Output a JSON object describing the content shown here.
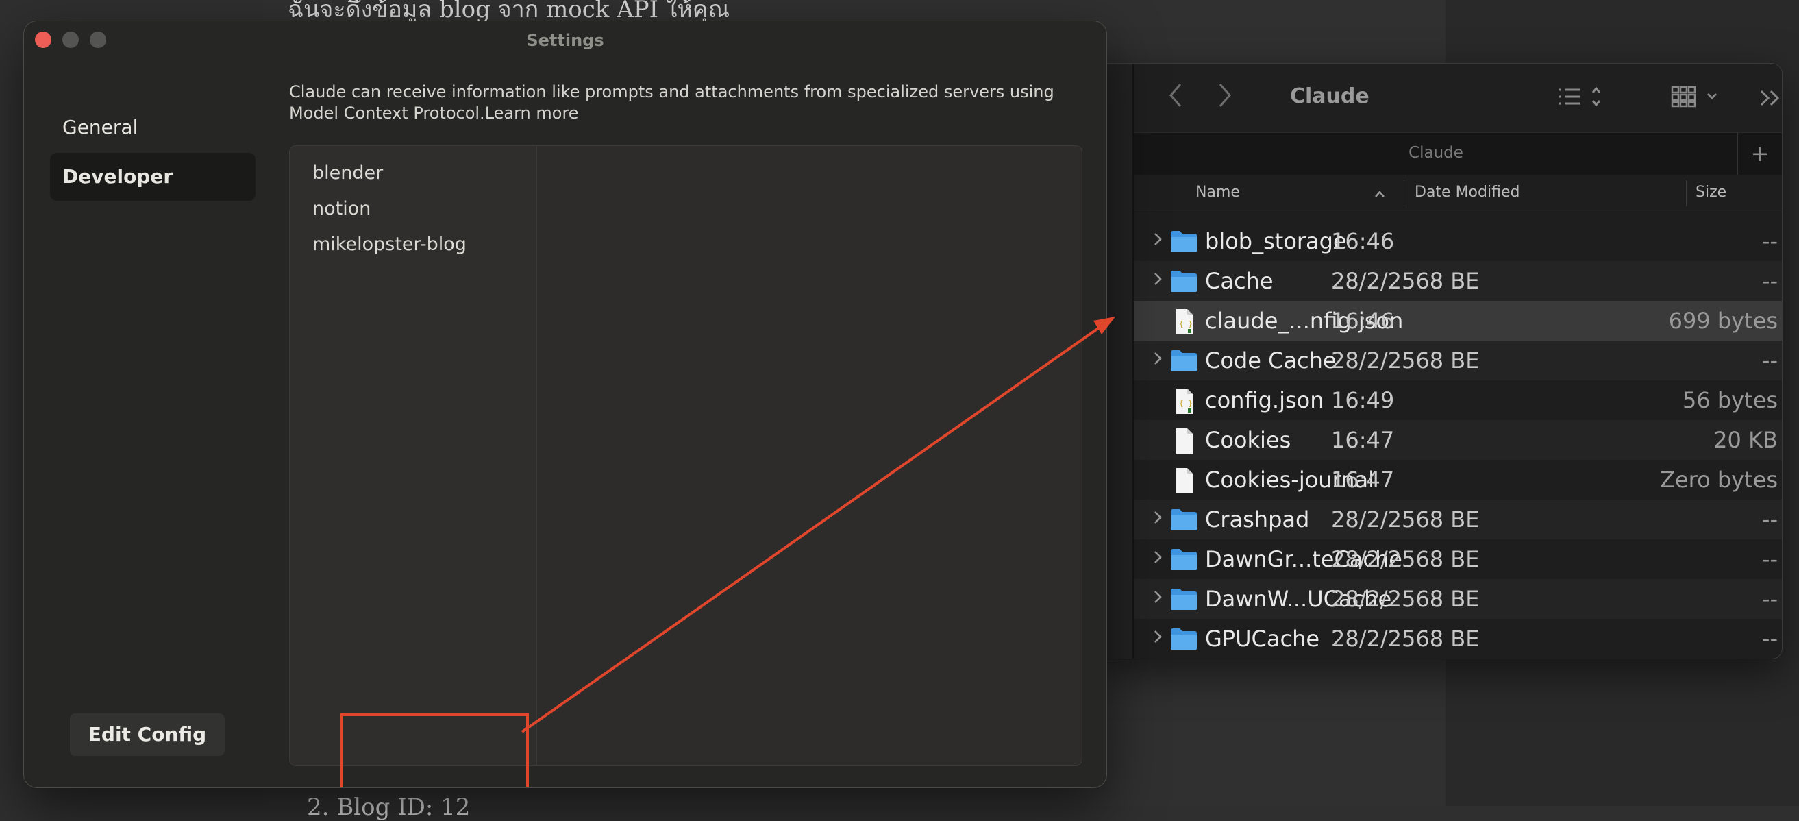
{
  "background": {
    "top_text": "ฉันจะดึงข้อมูล blog จาก mock API ให้คุณ",
    "bottom_text": "2. Blog ID: 12"
  },
  "settings": {
    "title": "Settings",
    "nav": [
      {
        "label": "General",
        "active": false
      },
      {
        "label": "Developer",
        "active": true
      }
    ],
    "description": "Claude can receive information like prompts and attachments from specialized servers using Model Context Protocol.",
    "learn_more": "Learn more",
    "servers": [
      "blender",
      "notion",
      "mikelopster-blog"
    ],
    "edit_config_label": "Edit Config"
  },
  "finder": {
    "title": "Claude",
    "tab_label": "Claude",
    "columns": {
      "name": "Name",
      "date": "Date Modified",
      "size": "Size"
    },
    "rows": [
      {
        "name": "blob_storage",
        "date": "16:46",
        "size": "--",
        "type": "folder"
      },
      {
        "name": "Cache",
        "date": "28/2/2568 BE",
        "size": "--",
        "type": "folder"
      },
      {
        "name": "claude_...nfig.json",
        "date": "16:46",
        "size": "699 bytes",
        "type": "json",
        "selected": true
      },
      {
        "name": "Code Cache",
        "date": "28/2/2568 BE",
        "size": "--",
        "type": "folder"
      },
      {
        "name": "config.json",
        "date": "16:49",
        "size": "56 bytes",
        "type": "json"
      },
      {
        "name": "Cookies",
        "date": "16:47",
        "size": "20 KB",
        "type": "file"
      },
      {
        "name": "Cookies-journal",
        "date": "16:47",
        "size": "Zero bytes",
        "type": "file"
      },
      {
        "name": "Crashpad",
        "date": "28/2/2568 BE",
        "size": "--",
        "type": "folder"
      },
      {
        "name": "DawnGr...teCache",
        "date": "28/2/2568 BE",
        "size": "--",
        "type": "folder"
      },
      {
        "name": "DawnW...UCache",
        "date": "28/2/2568 BE",
        "size": "--",
        "type": "folder"
      },
      {
        "name": "GPUCache",
        "date": "28/2/2568 BE",
        "size": "--",
        "type": "folder"
      }
    ]
  },
  "colors": {
    "annotation_red": "#e0462c",
    "folder_blue": "#5aaef0",
    "close_red": "#ed5f56"
  },
  "icons": {
    "back": "chevron-left-icon",
    "forward": "chevron-right-icon",
    "list_view": "list-view-icon",
    "grid_view": "grid-view-icon",
    "more": "double-chevron-icon",
    "search": "search-icon",
    "folder": "folder-icon",
    "json": "json-file-icon",
    "file": "file-icon"
  }
}
